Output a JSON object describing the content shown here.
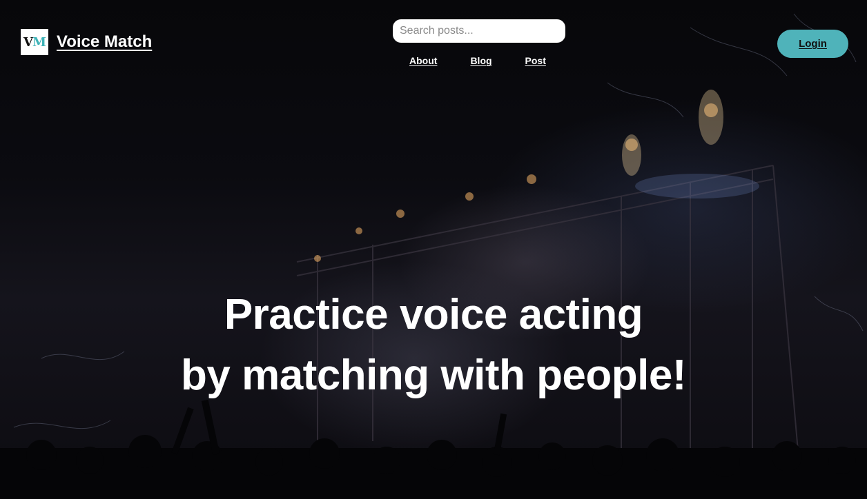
{
  "brand": {
    "logo_mark_v": "V",
    "logo_mark_m": "M",
    "name": "Voice Match",
    "accent": "#4fb3ba"
  },
  "search": {
    "placeholder": "Search posts...",
    "value": ""
  },
  "nav": {
    "about": "About",
    "blog": "Blog",
    "post": "Post"
  },
  "login": {
    "label": "Login"
  },
  "hero": {
    "line1": "Practice voice acting",
    "line2": "by matching with people!"
  }
}
